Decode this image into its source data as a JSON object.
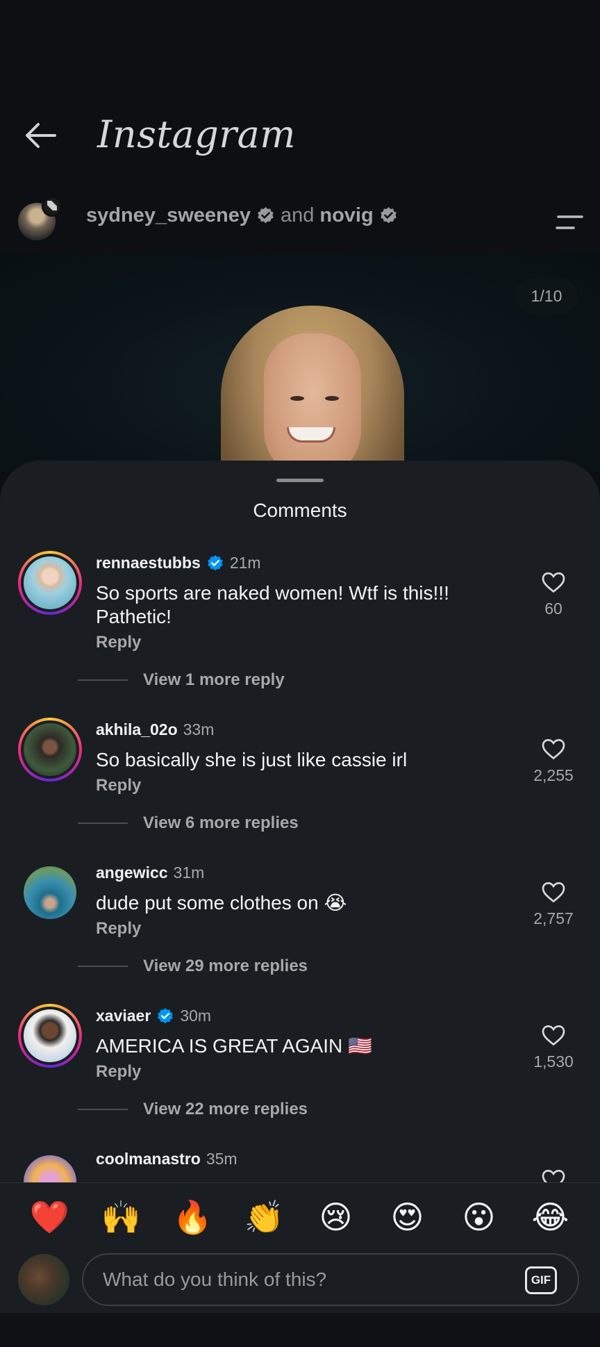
{
  "app": {
    "wordmark": "Instagram"
  },
  "post": {
    "author_1": "sydney_sweeney",
    "joiner": "and",
    "author_2": "novig",
    "counter": "1/10"
  },
  "sheet": {
    "title": "Comments"
  },
  "comments": [
    {
      "user": "rennaestubbs",
      "verified": true,
      "time": "21m",
      "text": "So sports are naked women! Wtf is this!!! Pathetic!",
      "reply": "Reply",
      "likes": "60",
      "view_more": "View 1 more reply"
    },
    {
      "user": "akhila_02o",
      "verified": false,
      "time": "33m",
      "text": "So basically she is just like cassie irl",
      "reply": "Reply",
      "likes": "2,255",
      "view_more": "View 6 more replies"
    },
    {
      "user": "angewicc",
      "verified": false,
      "time": "31m",
      "text": "dude put some clothes on 😭",
      "reply": "Reply",
      "likes": "2,757",
      "view_more": "View 29 more replies"
    },
    {
      "user": "xaviaer",
      "verified": true,
      "time": "30m",
      "text": "AMERICA IS GREAT AGAIN 🇺🇸",
      "reply": "Reply",
      "likes": "1,530",
      "view_more": "View 22 more replies"
    },
    {
      "user": "coolmanastro",
      "verified": false,
      "time": "35m"
    }
  ],
  "reactions": [
    "❤️",
    "🙌",
    "🔥",
    "👏",
    "😢",
    "😍",
    "😮",
    "😂"
  ],
  "composer": {
    "placeholder": "What do you think of this?",
    "gif_label": "GIF"
  },
  "colors": {
    "accent_verified": "#0095f6",
    "sheet_bg": "#1a1d21",
    "background": "#0d0f12"
  }
}
